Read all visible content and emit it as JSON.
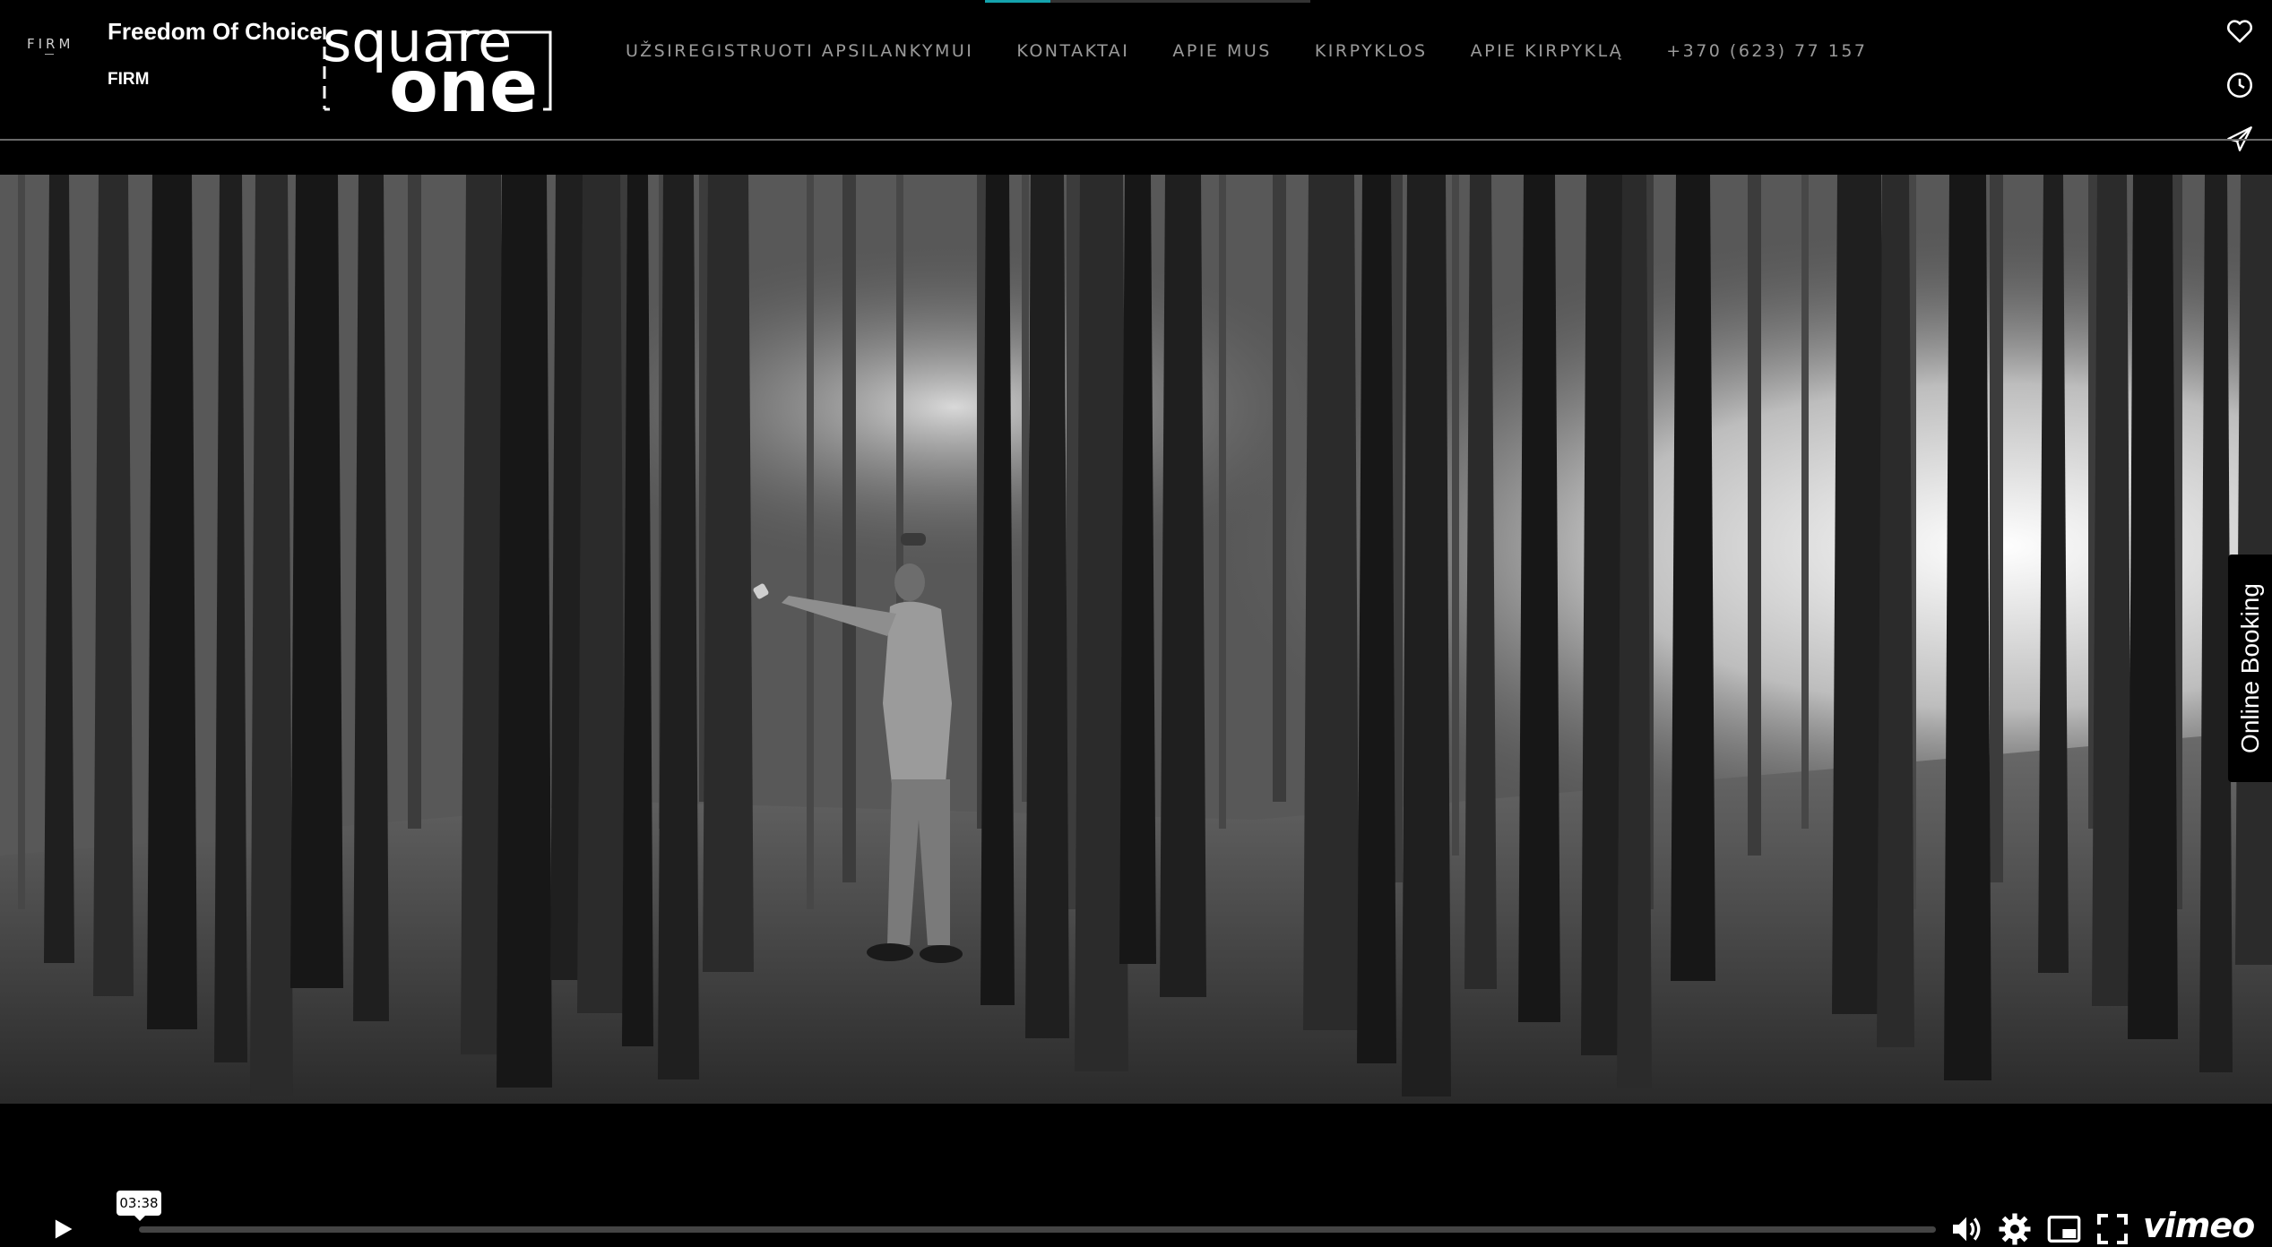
{
  "header": {
    "firm_small": "FIRM",
    "site_title": "Freedom Of Choice",
    "site_subtitle": "FIRM",
    "logo": {
      "line1": "square",
      "line2": "one",
      "icon": "square-one-logo"
    },
    "top_progress": {
      "played_fraction": 0.2
    },
    "nav": [
      "UŽSIREGISTRUOTI APSILANKYMUI",
      "KONTAKTAI",
      "APIE MUS",
      "KIRPYKLOS",
      "APIE KIRPYKLĄ",
      "+370 (623) 77 157"
    ],
    "side_icons": [
      "heart-icon",
      "clock-icon",
      "send-icon"
    ]
  },
  "booking": {
    "label": "Online Booking"
  },
  "player": {
    "time_tooltip": "03:38",
    "played_fraction": 0.0,
    "controls": [
      "play-icon",
      "volume-icon",
      "settings-icon",
      "pip-icon",
      "fullscreen-icon"
    ],
    "brand": "vimeo"
  },
  "colors": {
    "accent": "#14a3ad",
    "background": "#000000",
    "nav_text": "#9a9a9a"
  }
}
